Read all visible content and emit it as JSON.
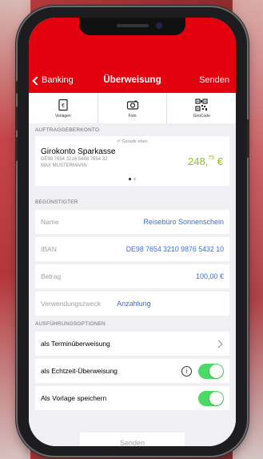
{
  "nav": {
    "back_label": "Banking",
    "title": "Überweisung",
    "send_label": "Senden"
  },
  "shortcuts": [
    {
      "label": "Vorlagen",
      "icon": "template-icon"
    },
    {
      "label": "Foto",
      "icon": "camera-icon"
    },
    {
      "label": "GiroCode",
      "icon": "qr-code-icon"
    }
  ],
  "sections": {
    "auftraggeber": "AUFTRAGGEBERKONTO",
    "beguenstigter": "BEGÜNSTIGTER",
    "ausfuehrung": "AUSFÜHRUNGSOPTIONEN"
  },
  "account": {
    "updated": "Gerade eben",
    "name": "Girokonto Sparkasse",
    "iban": "DE98 7654 3216 5498 7654 32",
    "owner": "MAX MUSTERMANN",
    "balance_main": "248,",
    "balance_cents": "75",
    "currency": " €",
    "page_count": 2,
    "page_active": 1
  },
  "beneficiary": {
    "name_label": "Name",
    "name_value": "Reisebüro Sonnenschein",
    "iban_label": "IBAN",
    "iban_value": "DE98 7654 3210 9876 5432 10",
    "amount_label": "Betrag",
    "amount_value": "100,00 €",
    "purpose_label": "Verwendungszweck",
    "purpose_value": "Anzahlung"
  },
  "options": {
    "termin_label": "als Terminüberweisung",
    "realtime_label": "als Echtzeit-Überweisung",
    "realtime_on": true,
    "template_label": "Als Vorlage speichern",
    "template_on": true
  },
  "send_button": "Senden",
  "colors": {
    "brand": "#e3000f",
    "link": "#3c6ad8",
    "balance": "#8fbf1e",
    "toggle_on": "#4cd964"
  }
}
